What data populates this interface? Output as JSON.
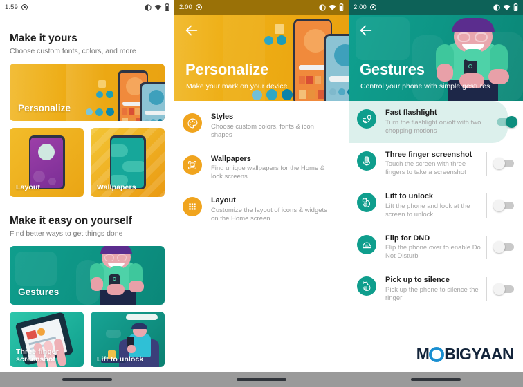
{
  "watermark": {
    "pre": "M",
    "post": "BIGYAAN"
  },
  "left": {
    "statusbar": {
      "time": "1:59",
      "icons": [
        "dnd-icon",
        "wifi-icon",
        "battery-icon"
      ]
    },
    "sections": [
      {
        "title": "Make it yours",
        "subtitle": "Choose custom fonts, colors, and more",
        "hero": {
          "label": "Personalize"
        },
        "cards": [
          {
            "label": "Layout"
          },
          {
            "label": "Wallpapers"
          }
        ]
      },
      {
        "title": "Make it easy on yourself",
        "subtitle": "Find better ways to get things done",
        "hero": {
          "label": "Gestures"
        },
        "cards": [
          {
            "label": "Three finger screenshot"
          },
          {
            "label": "Lift to unlock"
          }
        ]
      }
    ]
  },
  "middle": {
    "statusbar": {
      "time": "2:00"
    },
    "hero": {
      "title": "Personalize",
      "subtitle": "Make your mark on your device",
      "back": "back-arrow"
    },
    "items": [
      {
        "title": "Styles",
        "desc": "Choose custom colors, fonts & icon shapes",
        "icon": "palette-icon"
      },
      {
        "title": "Wallpapers",
        "desc": "Find unique wallpapers for the Home & lock screens",
        "icon": "wallpaper-icon"
      },
      {
        "title": "Layout",
        "desc": "Customize the layout of icons & widgets on the Home screen",
        "icon": "grid-icon"
      }
    ],
    "accent": "#F0A41E"
  },
  "right": {
    "statusbar": {
      "time": "2:00"
    },
    "hero": {
      "title": "Gestures",
      "subtitle": "Control your phone with simple gestures",
      "back": "back-arrow"
    },
    "items": [
      {
        "title": "Fast flashlight",
        "desc": "Turn the flashlight on/off with two chopping motions",
        "icon": "chop-flashlight-icon",
        "toggle": "on",
        "selected": true
      },
      {
        "title": "Three finger screenshot",
        "desc": "Touch the screen with three fingers to take a screenshot",
        "icon": "three-finger-icon",
        "toggle": "off",
        "selected": false
      },
      {
        "title": "Lift to unlock",
        "desc": "Lift the phone and look at the screen to unlock",
        "icon": "lift-unlock-icon",
        "toggle": "off",
        "selected": false
      },
      {
        "title": "Flip for DND",
        "desc": "Flip the phone over to enable Do Not Disturb",
        "icon": "flip-dnd-icon",
        "toggle": "off",
        "selected": false
      },
      {
        "title": "Pick up to silence",
        "desc": "Pick up the phone to silence the ringer",
        "icon": "pickup-silence-icon",
        "toggle": "off",
        "selected": false
      }
    ],
    "accent": "#0F9E8D"
  }
}
